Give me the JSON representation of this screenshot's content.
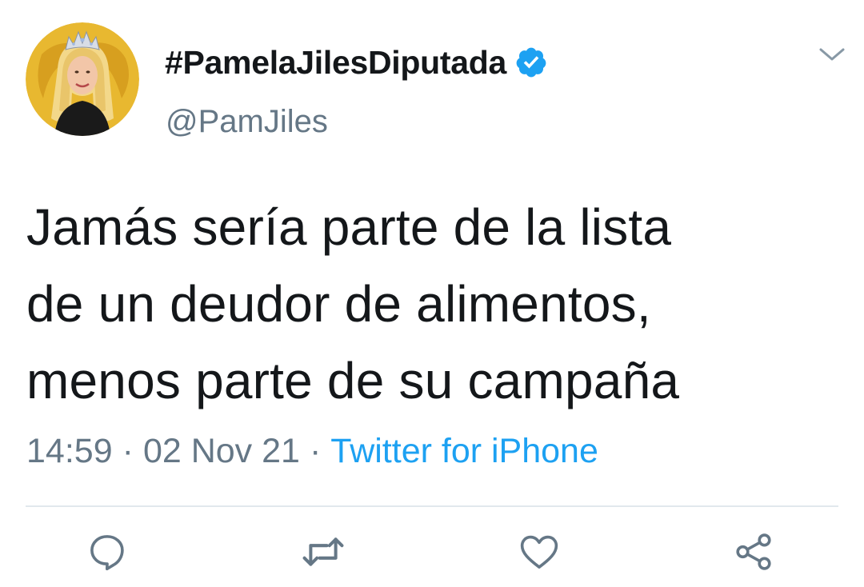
{
  "author": {
    "display_name": "#PamelaJilesDiputada",
    "handle": "@PamJiles",
    "verified": true,
    "avatar_icon": "profile-photo-avatar"
  },
  "tweet": {
    "text_lines": [
      "Jamás sería parte de la lista",
      "de un deudor de alimentos,",
      "menos parte de su campaña"
    ],
    "time": "14:59",
    "date": "02 Nov 21",
    "separator": "·",
    "source": "Twitter for iPhone"
  },
  "actions": [
    {
      "icon": "reply-icon"
    },
    {
      "icon": "retweet-icon"
    },
    {
      "icon": "like-icon"
    },
    {
      "icon": "share-icon"
    }
  ],
  "colors": {
    "text": "#14171a",
    "secondary": "#657786",
    "accent": "#1da1f2",
    "divider": "#e1e8ed",
    "avatar_bg": "#e8b830"
  }
}
